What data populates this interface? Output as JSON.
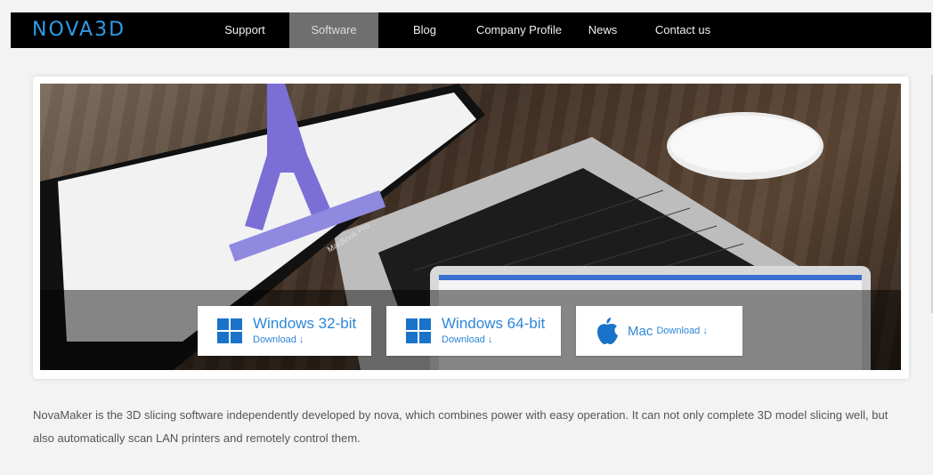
{
  "nav": {
    "logo": "NOVA3D",
    "items": [
      {
        "label": "Support"
      },
      {
        "label": "Software",
        "active": true
      },
      {
        "label": "Blog"
      },
      {
        "label": "Company Profile"
      },
      {
        "label": "News"
      },
      {
        "label": "Contact us"
      }
    ]
  },
  "hero": {
    "buttons": [
      {
        "title": "Windows 32-bit",
        "sub": "Download ↓",
        "icon": "windows-icon"
      },
      {
        "title": "Windows 64-bit",
        "sub": "Download ↓",
        "icon": "windows-icon"
      },
      {
        "title": "Mac",
        "sub": "Download ↓",
        "icon": "apple-icon"
      }
    ],
    "laptop_label": "MacBook Pro"
  },
  "description": "NovaMaker is the 3D slicing software independently developed by nova, which combines power with easy operation. It can not only complete 3D model slicing well, but also automatically scan LAN printers and remotely control them.",
  "colors": {
    "nav_bg": "#000000",
    "logo": "#2f9be8",
    "active_tab": "#6f6f6f",
    "link_blue": "#2d87d6",
    "windows_blue": "#1a73c8"
  }
}
